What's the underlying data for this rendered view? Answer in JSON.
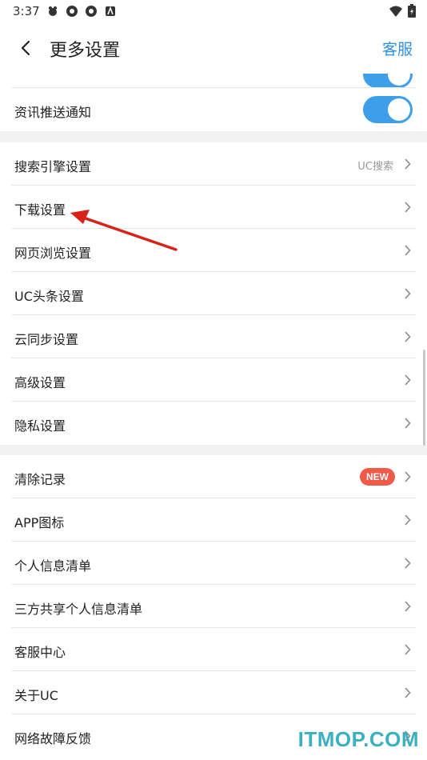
{
  "status": {
    "time": "3:37"
  },
  "appbar": {
    "title": "更多设置",
    "service_label": "客服"
  },
  "sections": {
    "notify": {
      "push_label": "资讯推送通知",
      "push_toggle_on": true,
      "partial_toggle_on": true
    },
    "general": {
      "search_engine_label": "搜索引擎设置",
      "search_engine_value": "UC搜索",
      "download_label": "下载设置",
      "browse_label": "网页浏览设置",
      "headline_label": "UC头条设置",
      "cloud_sync_label": "云同步设置",
      "advanced_label": "高级设置",
      "privacy_label": "隐私设置"
    },
    "other": {
      "clear_label": "清除记录",
      "clear_badge": "NEW",
      "app_icon_label": "APP图标",
      "personal_info_label": "个人信息清单",
      "third_party_label": "三方共享个人信息清单",
      "service_center_label": "客服中心",
      "about_label": "关于UC",
      "network_label": "网络故障反馈"
    }
  },
  "watermark": "ITMOP.COM",
  "colors": {
    "accent": "#3d9fea",
    "link": "#2f8fe4",
    "badge": "#f05a4a",
    "arrow": "#d8221a",
    "watermark": "#3bb0c0"
  }
}
